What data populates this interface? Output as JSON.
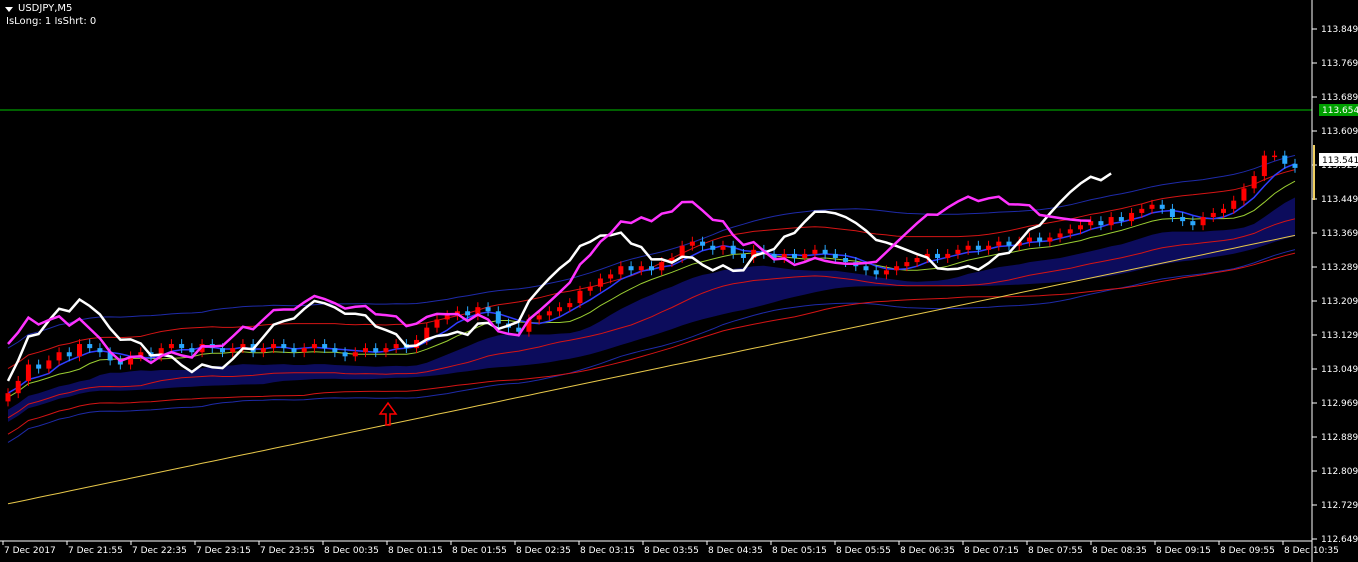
{
  "window": {
    "title": "USDJPY,M5",
    "status": "IsLong: 1 IsShrt: 0"
  },
  "colors": {
    "background": "#000000",
    "axis": "#ffffff",
    "bull_candle": "#ff0000",
    "bear_candle": "#2aa8ff",
    "ichimoku_cloud": "#1a1acc",
    "target_line": "#00c000",
    "current_price_tag": "#ffffff",
    "arrow": "#ff0000"
  },
  "price_axis": {
    "ticks": [
      "113.849",
      "113.769",
      "113.689",
      "113.609",
      "113.529",
      "113.449",
      "113.369",
      "113.289",
      "113.209",
      "113.129",
      "113.049",
      "112.969",
      "112.889",
      "112.809",
      "112.729",
      "112.649"
    ],
    "target_label": "113.654",
    "current_label": "113.541"
  },
  "time_axis": {
    "ticks": [
      "7 Dec 2017",
      "7 Dec 21:55",
      "7 Dec 22:35",
      "7 Dec 23:15",
      "7 Dec 23:55",
      "8 Dec 00:35",
      "8 Dec 01:15",
      "8 Dec 01:55",
      "8 Dec 02:35",
      "8 Dec 03:15",
      "8 Dec 03:55",
      "8 Dec 04:35",
      "8 Dec 05:15",
      "8 Dec 05:55",
      "8 Dec 06:35",
      "8 Dec 07:15",
      "8 Dec 07:55",
      "8 Dec 08:35",
      "8 Dec 09:15",
      "8 Dec 09:55",
      "8 Dec 10:35"
    ]
  },
  "chart_data": {
    "type": "candlestick",
    "symbol": "USDJPY",
    "timeframe": "M5",
    "ylim": [
      112.649,
      113.889
    ],
    "target_price": 113.654,
    "last_price": 113.541,
    "signal": "buy arrow at 8 Dec 01:15",
    "closes": [
      113.0,
      113.03,
      113.07,
      113.06,
      113.08,
      113.1,
      113.09,
      113.12,
      113.11,
      113.1,
      113.08,
      113.07,
      113.09,
      113.1,
      113.09,
      113.11,
      113.12,
      113.11,
      113.1,
      113.12,
      113.11,
      113.1,
      113.11,
      113.12,
      113.1,
      113.11,
      113.12,
      113.11,
      113.1,
      113.11,
      113.12,
      113.11,
      113.1,
      113.09,
      113.1,
      113.11,
      113.1,
      113.11,
      113.12,
      113.11,
      113.13,
      113.16,
      113.18,
      113.19,
      113.2,
      113.19,
      113.21,
      113.2,
      113.17,
      113.16,
      113.15,
      113.18,
      113.19,
      113.2,
      113.21,
      113.22,
      113.25,
      113.26,
      113.28,
      113.29,
      113.31,
      113.3,
      113.31,
      113.3,
      113.32,
      113.33,
      113.36,
      113.37,
      113.36,
      113.35,
      113.36,
      113.34,
      113.33,
      113.35,
      113.34,
      113.33,
      113.34,
      113.33,
      113.34,
      113.35,
      113.34,
      113.33,
      113.32,
      113.31,
      113.3,
      113.29,
      113.3,
      113.31,
      113.32,
      113.33,
      113.34,
      113.33,
      113.34,
      113.35,
      113.36,
      113.35,
      113.36,
      113.37,
      113.36,
      113.37,
      113.38,
      113.37,
      113.38,
      113.39,
      113.4,
      113.41,
      113.42,
      113.41,
      113.43,
      113.42,
      113.44,
      113.45,
      113.46,
      113.45,
      113.43,
      113.42,
      113.41,
      113.43,
      113.44,
      113.45,
      113.47,
      113.5,
      113.53,
      113.58,
      113.58,
      113.56,
      113.55
    ]
  }
}
